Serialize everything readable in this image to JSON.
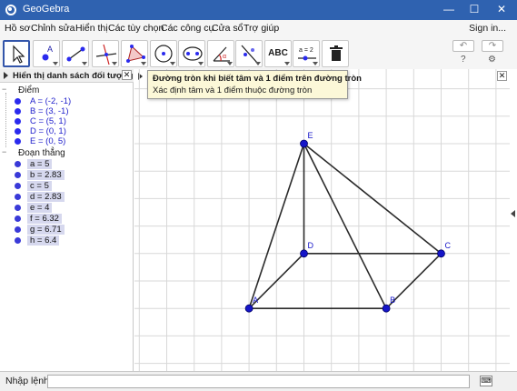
{
  "window": {
    "title": "GeoGebra",
    "controls": [
      "—",
      "☐",
      "✕"
    ]
  },
  "menu": {
    "items": [
      "Hồ sơ",
      "Chỉnh sửa",
      "Hiển thị",
      "Các tùy chọn",
      "Các công cụ",
      "Cửa sổ",
      "Trợ giúp"
    ],
    "sign_in": "Sign in..."
  },
  "toolbar": {
    "tools": [
      "move-tool",
      "point-tool",
      "segment-tool",
      "perpendicular-line-tool",
      "polygon-tool",
      "circle-center-point-tool",
      "conic-tool",
      "angle-tool",
      "reflect-tool",
      "text-tool",
      "slider-tool",
      "delete-tool"
    ],
    "text_tool_label": "ABC",
    "slider_tool_label": "a = 2",
    "undo": "↶",
    "redo": "↷",
    "help": "?",
    "settings": "⚙"
  },
  "tooltip": {
    "title": "Đường tròn khi biết tâm và 1 điểm trên đường tròn",
    "description": "Xác định tâm và 1 điểm thuộc đường tròn"
  },
  "algebra": {
    "header": "Hiển thị danh sách đối tượng",
    "groups": [
      {
        "name": "Điểm",
        "items": [
          "A = (-2, -1)",
          "B = (3, -1)",
          "C = (5, 1)",
          "D = (0, 1)",
          "E = (0, 5)"
        ]
      },
      {
        "name": "Đoạn thẳng",
        "items": [
          "a = 5",
          "b = 2.83",
          "c = 5",
          "d = 2.83",
          "e = 4",
          "f = 6.32",
          "g = 6.71",
          "h = 6.4"
        ]
      }
    ]
  },
  "graphics": {
    "points": [
      {
        "label": "A",
        "x": -2,
        "y": -1
      },
      {
        "label": "B",
        "x": 3,
        "y": -1
      },
      {
        "label": "C",
        "x": 5,
        "y": 1
      },
      {
        "label": "D",
        "x": 0,
        "y": 1
      },
      {
        "label": "E",
        "x": 0,
        "y": 5
      }
    ],
    "segments": [
      {
        "name": "a",
        "from": "A",
        "to": "B"
      },
      {
        "name": "b",
        "from": "B",
        "to": "C"
      },
      {
        "name": "c",
        "from": "C",
        "to": "D"
      },
      {
        "name": "d",
        "from": "D",
        "to": "A"
      },
      {
        "name": "e",
        "from": "D",
        "to": "E"
      },
      {
        "name": "f",
        "from": "A",
        "to": "E"
      },
      {
        "name": "g",
        "from": "B",
        "to": "E"
      },
      {
        "name": "h",
        "from": "C",
        "to": "E"
      }
    ],
    "point_color": "#1515c8",
    "segment_color": "#2b2b2b",
    "grid_color": "#d8d8d8",
    "grid": true,
    "axes": false
  },
  "input_bar": {
    "label": "Nhập lệnh:",
    "value": "",
    "keyboard_icon": "⌨"
  },
  "colors": {
    "titlebar": "#2f62b0",
    "point_dot": "#2a2aee",
    "segment_highlight": "#d6d8ee"
  }
}
